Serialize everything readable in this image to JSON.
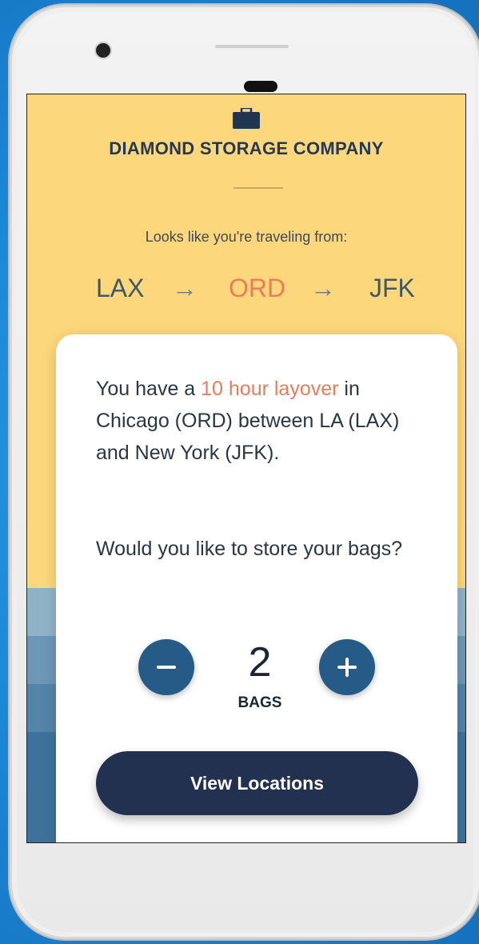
{
  "header": {
    "brand_icon": "briefcase-icon",
    "brand_name": "DIAMOND STORAGE COMPANY"
  },
  "trip": {
    "intro": "Looks like you're traveling from:",
    "origin": "LAX",
    "arrow": "→",
    "layover": "ORD",
    "destination": "JFK"
  },
  "card": {
    "message_prefix": "You have a ",
    "message_highlight": "10 hour layover",
    "message_suffix": " in Chicago (ORD) between LA (LAX) and New York (JFK).",
    "question": "Would you like to store your bags?",
    "bag_count": "2",
    "bag_label": "BAGS",
    "decrease_icon": "minus-icon",
    "increase_icon": "plus-icon",
    "cta_label": "View Locations"
  },
  "colors": {
    "background_yellow": "#fdd77b",
    "accent_orange": "#ea7c5b",
    "stepper_blue": "#265b87",
    "button_navy": "#22314f",
    "text_dark": "#263954"
  }
}
